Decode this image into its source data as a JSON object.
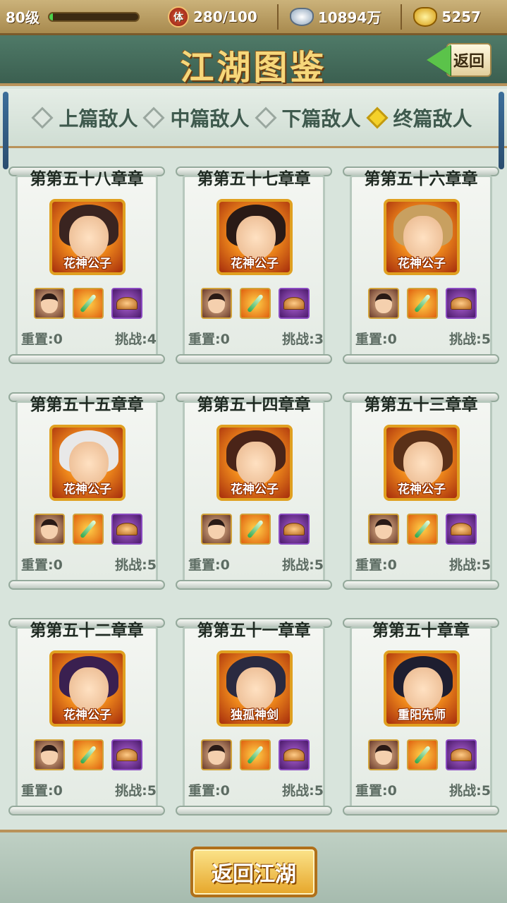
{
  "status": {
    "level": "80级",
    "stamina_icon_char": "体",
    "stamina": "280/100",
    "silver": "10894万",
    "gold": "5257",
    "xp_fraction": 0.04
  },
  "header": {
    "title": "江湖图鉴",
    "back_label": "返回"
  },
  "tabs": [
    {
      "label": "上篇敌人",
      "active": false
    },
    {
      "label": "中篇敌人",
      "active": false
    },
    {
      "label": "下篇敌人",
      "active": false
    },
    {
      "label": "终篇敌人",
      "active": true
    }
  ],
  "cards": [
    {
      "chapter": "第第五十八章章",
      "enemy": "花神公子",
      "reset": "重置:0",
      "challenge": "挑战:4"
    },
    {
      "chapter": "第第五十七章章",
      "enemy": "花神公子",
      "reset": "重置:0",
      "challenge": "挑战:3"
    },
    {
      "chapter": "第第五十六章章",
      "enemy": "花神公子",
      "reset": "重置:0",
      "challenge": "挑战:5"
    },
    {
      "chapter": "第第五十五章章",
      "enemy": "花神公子",
      "reset": "重置:0",
      "challenge": "挑战:5"
    },
    {
      "chapter": "第第五十四章章",
      "enemy": "花神公子",
      "reset": "重置:0",
      "challenge": "挑战:5"
    },
    {
      "chapter": "第第五十三章章",
      "enemy": "花神公子",
      "reset": "重置:0",
      "challenge": "挑战:5"
    },
    {
      "chapter": "第第五十二章章",
      "enemy": "花神公子",
      "reset": "重置:0",
      "challenge": "挑战:5"
    },
    {
      "chapter": "第第五十一章章",
      "enemy": "独孤神剑",
      "reset": "重置:0",
      "challenge": "挑战:5"
    },
    {
      "chapter": "第第五十章章",
      "enemy": "重阳先师",
      "reset": "重置:0",
      "challenge": "挑战:5"
    }
  ],
  "footer": {
    "return_label": "返回江湖"
  }
}
